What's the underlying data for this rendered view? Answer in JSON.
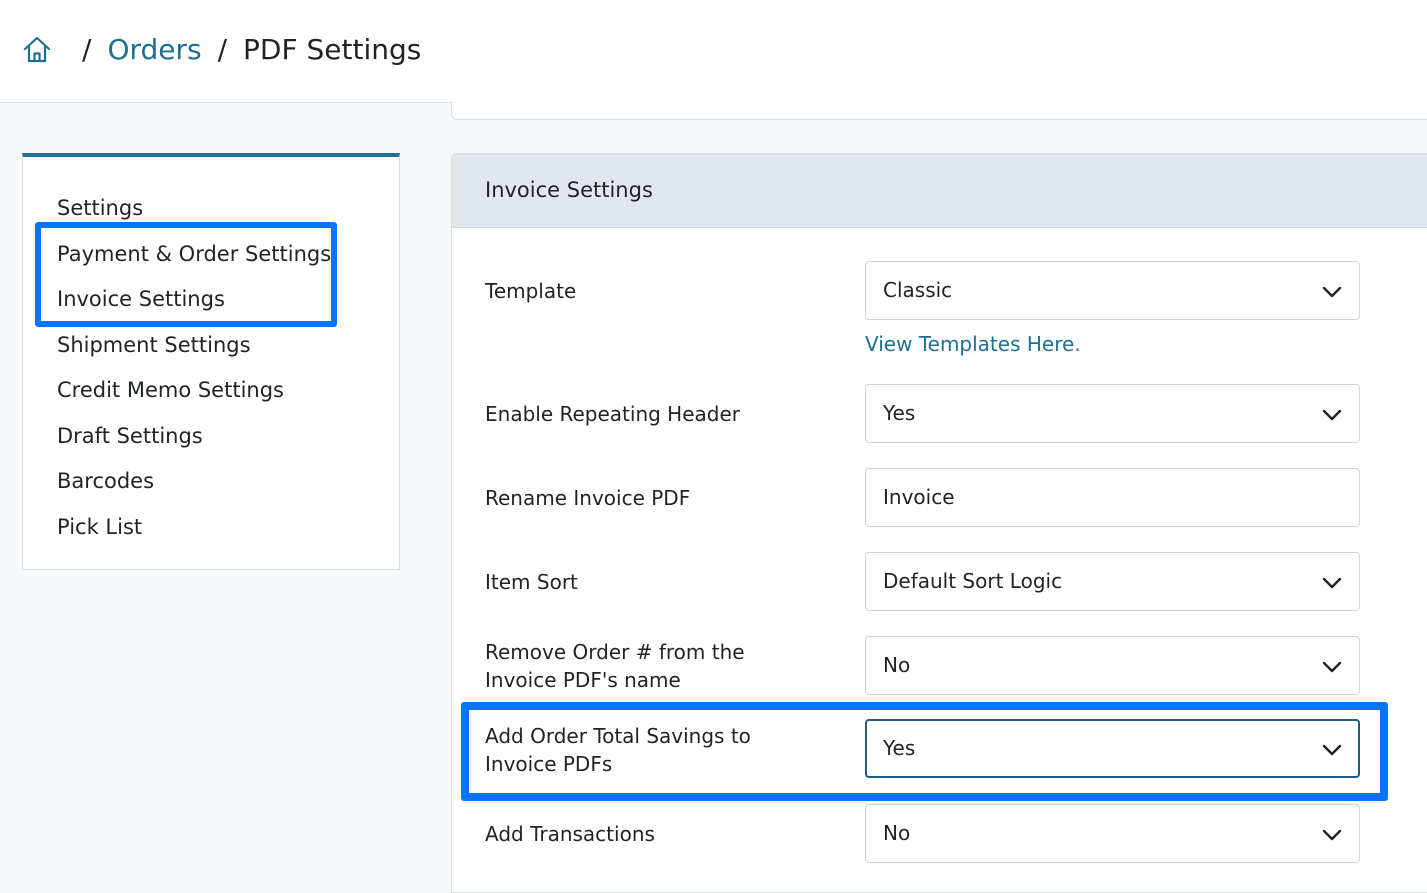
{
  "breadcrumb": {
    "home_icon": "home-icon",
    "separator": "/",
    "orders": "Orders",
    "current": "PDF Settings"
  },
  "sidenav": {
    "items": [
      {
        "label": "Settings"
      },
      {
        "label": "Payment & Order Settings"
      },
      {
        "label": "Invoice Settings"
      },
      {
        "label": "Shipment Settings"
      },
      {
        "label": "Credit Memo Settings"
      },
      {
        "label": "Draft Settings"
      },
      {
        "label": "Barcodes"
      },
      {
        "label": "Pick List"
      }
    ]
  },
  "invoice": {
    "title": "Invoice Settings",
    "template": {
      "label": "Template",
      "value": "Classic",
      "link": "View Templates Here."
    },
    "repeating_header": {
      "label": "Enable Repeating Header",
      "value": "Yes"
    },
    "rename_pdf": {
      "label": "Rename Invoice PDF",
      "value": "Invoice"
    },
    "item_sort": {
      "label": "Item Sort",
      "value": "Default Sort Logic"
    },
    "remove_order_num": {
      "label": "Remove Order # from the Invoice PDF's name",
      "value": "No"
    },
    "order_total_savings": {
      "label": "Add Order Total Savings to Invoice PDFs",
      "value": "Yes"
    },
    "add_transactions": {
      "label": "Add Transactions",
      "value": "No"
    }
  },
  "colors": {
    "accent": "#1f6f94",
    "highlight": "#0a74ff",
    "header_bg": "#e1e7ed"
  }
}
